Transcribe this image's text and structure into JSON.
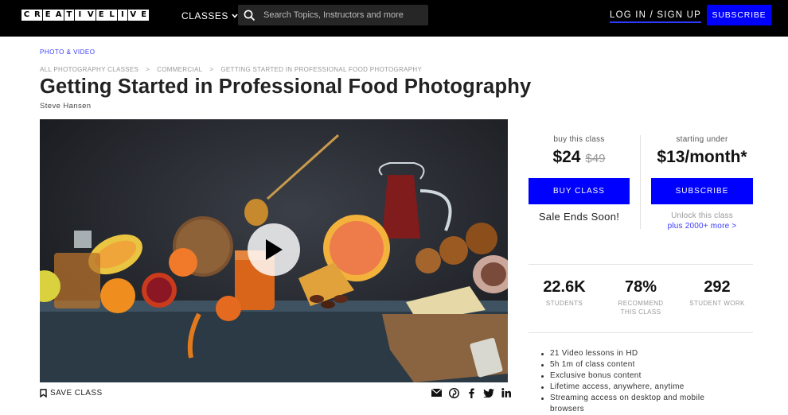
{
  "header": {
    "logo_letters": [
      "C",
      "R",
      "E",
      "A",
      "T",
      "I",
      "V",
      "E",
      "L",
      "I",
      "V",
      "E"
    ],
    "classes_label": "CLASSES",
    "search_placeholder": "Search Topics, Instructors and more",
    "login_label": "LOG IN / SIGN UP",
    "subscribe_label": "SUBSCRIBE",
    "accent_color": "#0000ff"
  },
  "page": {
    "category": "PHOTO & VIDEO",
    "breadcrumb": [
      "ALL PHOTOGRAPHY CLASSES",
      ">",
      "COMMERCIAL",
      ">",
      "GETTING STARTED IN PROFESSIONAL FOOD PHOTOGRAPHY"
    ],
    "title": "Getting Started in Professional Food Photography",
    "instructor": "Steve Hansen"
  },
  "video": {
    "play_icon": "play-icon",
    "save_label": "SAVE CLASS",
    "share_icons": [
      "email-icon",
      "pinterest-icon",
      "facebook-icon",
      "twitter-icon",
      "linkedin-icon"
    ]
  },
  "purchase": {
    "buy_label": "buy this class",
    "price": "$24",
    "old_price": "$49",
    "buy_button": "BUY CLASS",
    "sale_text": "Sale Ends Soon!",
    "sub_label": "starting under",
    "sub_price": "$13/month*",
    "sub_button": "SUBSCRIBE",
    "unlock_text": "Unlock this class",
    "unlock_more": "plus 2000+ more >"
  },
  "stats": [
    {
      "value": "22.6K",
      "label": "STUDENTS"
    },
    {
      "value": "78%",
      "label": "RECOMMEND THIS CLASS"
    },
    {
      "value": "292",
      "label": "STUDENT WORK"
    }
  ],
  "features": [
    "21 Video lessons in HD",
    "5h 1m of class content",
    "Exclusive bonus content",
    "Lifetime access, anywhere, anytime",
    "Streaming access on desktop and mobile browsers"
  ]
}
